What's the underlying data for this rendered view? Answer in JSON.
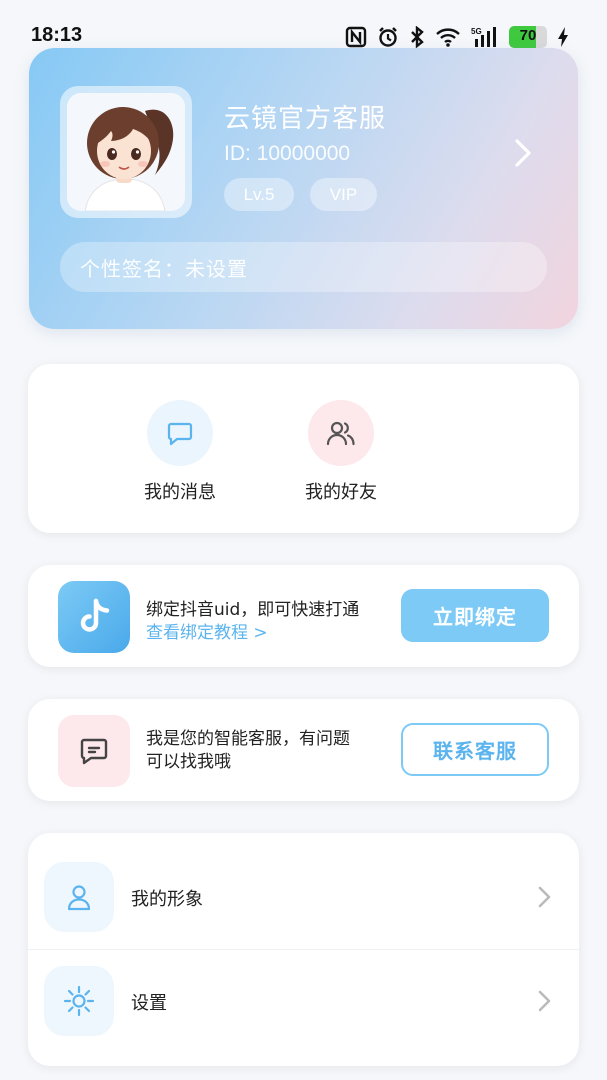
{
  "status_bar": {
    "time": "18:13",
    "battery": "70",
    "network": "5G",
    "icons": [
      "nfc-icon",
      "alarm-icon",
      "bluetooth-icon",
      "wifi-icon",
      "signal-icon",
      "battery-icon",
      "charging-icon"
    ]
  },
  "profile": {
    "name": "云镜官方客服",
    "id": "ID: 10000000",
    "level": "Lv.5",
    "vip": "VIP",
    "signature": "个性签名：未设置"
  },
  "quick_actions": [
    {
      "label": "我的消息",
      "icon": "message-icon"
    },
    {
      "label": "我的好友",
      "icon": "friends-icon"
    }
  ],
  "douyin_bind": {
    "text": "绑定抖音uid，即可快速打通",
    "link": "查看绑定教程 >",
    "button": "立即绑定",
    "icon": "tiktok-icon"
  },
  "service": {
    "line1": "我是您的智能客服，有问题",
    "line2": "可以找我哦",
    "button": "联系客服",
    "icon": "chat-icon"
  },
  "menu": [
    {
      "label": "我的形象",
      "icon": "user-icon"
    },
    {
      "label": "设置",
      "icon": "settings-icon"
    }
  ],
  "colors": {
    "accent": "#7ccaf5",
    "link": "#5bb4ee",
    "pink_bg": "#fde8ec",
    "blue_bg": "#eaf5fd"
  }
}
